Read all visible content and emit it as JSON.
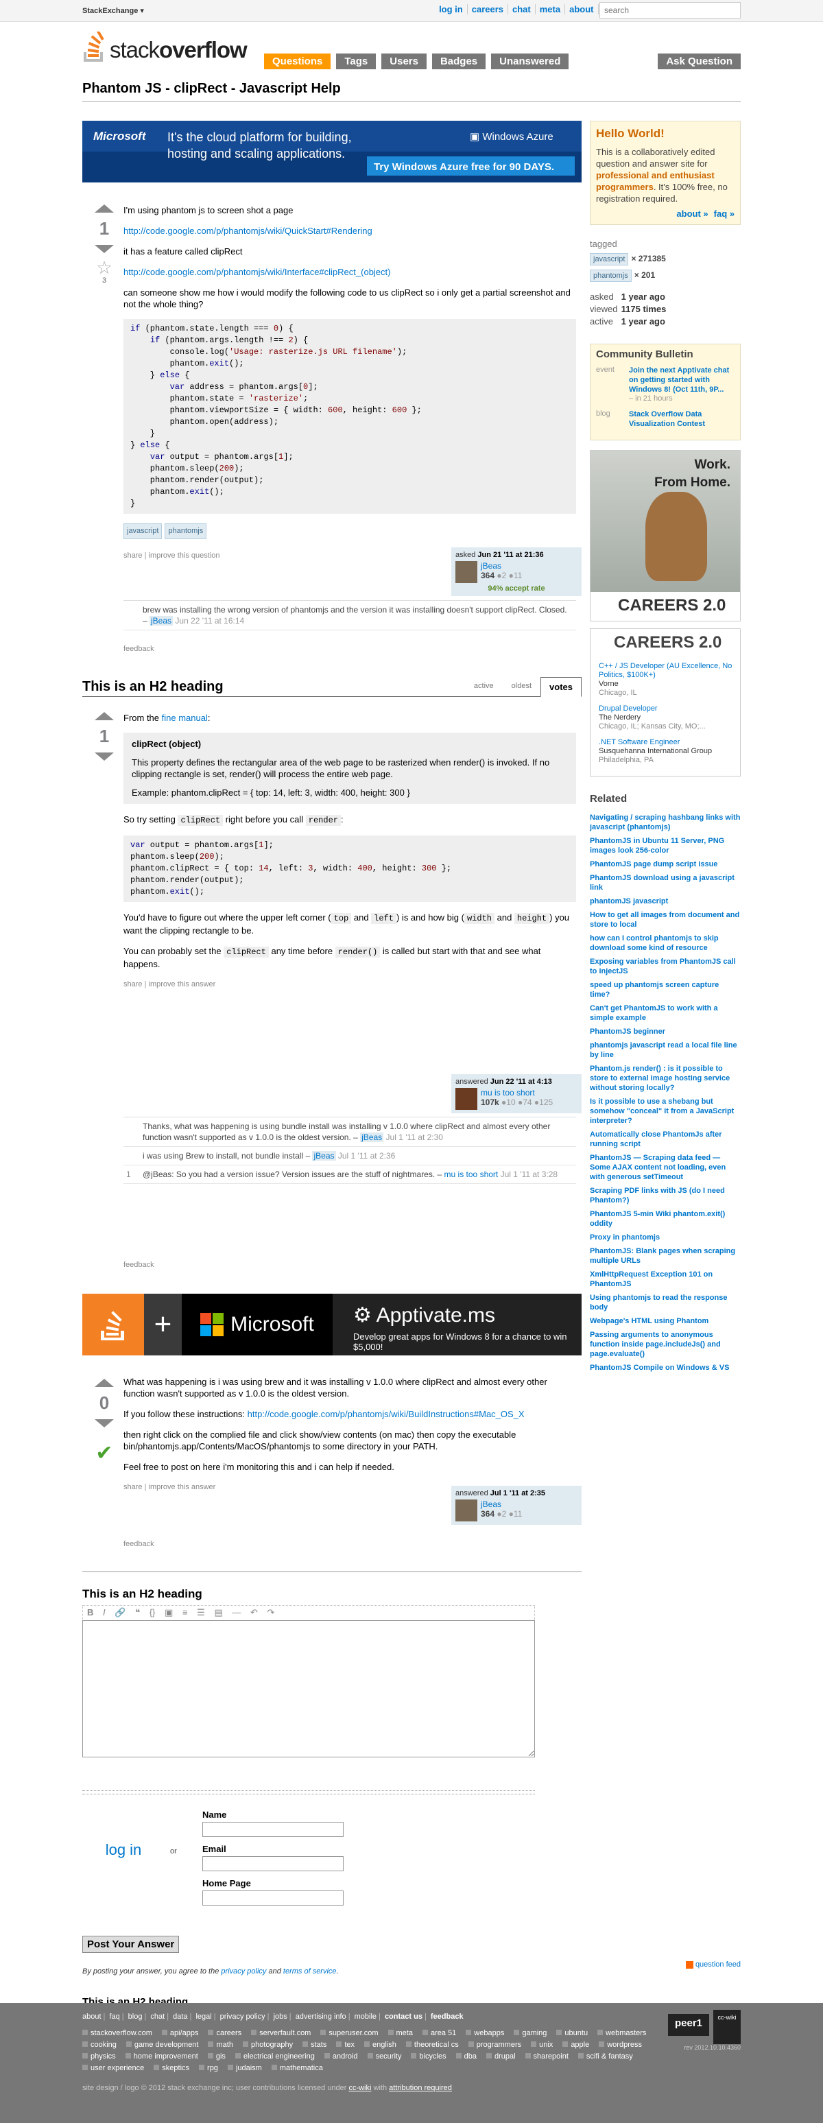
{
  "topbar": {
    "stackexchange_label": "StackExchange ▾",
    "links": [
      "log in",
      "careers",
      "chat",
      "meta",
      "about",
      "faq"
    ],
    "search_placeholder": "search"
  },
  "header": {
    "logo_text_light": "stack",
    "logo_text_bold": "overflow",
    "nav": [
      "Questions",
      "Tags",
      "Users",
      "Badges",
      "Unanswered"
    ],
    "ask_button": "Ask Question"
  },
  "question": {
    "title": "Phantom JS - clipRect - Javascript Help",
    "votes": "1",
    "favorites": "3",
    "p1": "I'm using phantom js to screen shot a page",
    "link1": "http://code.google.com/p/phantomjs/wiki/QuickStart#Rendering",
    "p2": "it has a feature called clipRect",
    "link2": "http://code.google.com/p/phantomjs/wiki/Interface#clipRect_(object)",
    "p3": "can someone show me how i would modify the following code to us clipRect so i only get a partial screenshot and not the whole thing?",
    "tags": [
      "javascript",
      "phantomjs"
    ],
    "menu": [
      "share",
      "improve this question"
    ],
    "sig_action": "asked ",
    "sig_date": "Jun 21 '11 at 21:36",
    "user": "jBeas",
    "rep": "364",
    "badges": "●2 ●11",
    "accept_rate": "94% accept rate",
    "comment_text": "brew was installing the wrong version of phantomjs and the version it was installing doesn't support clipRect. Closed. – ",
    "comment_user": "jBeas",
    "comment_date": "Jun 22 '11 at 16:14",
    "feedback": "feedback"
  },
  "answers_header": {
    "title": "This is an H2 heading",
    "tabs": [
      "active",
      "oldest",
      "votes"
    ]
  },
  "answer1": {
    "votes": "1",
    "p_intro": "From the ",
    "p_intro_link": "fine manual",
    "p_intro_end": ":",
    "bq_title": "clipRect (object)",
    "bq_text": "This property defines the rectangular area of the web page to be rasterized when render() is invoked. If no clipping rectangle is set, render() will process the entire web page.",
    "bq_example": "Example:   phantom.clipRect = { top: 14, left: 3, width: 400, height: 300 }",
    "p2a": "So try setting ",
    "p2_code": "clipRect",
    "p2b": " right before you call ",
    "p2_code2": "render",
    "p2c": ":",
    "p3a": "You'd have to figure out where the upper left corner (",
    "p3_top": "top",
    "p3b": " and ",
    "p3_left": "left",
    "p3c": ") is and how big (",
    "p3_width": "width",
    "p3d": " and ",
    "p3_height": "height",
    "p3e": ") you want the clipping rectangle to be.",
    "p4a": "You can probably set the ",
    "p4_code": "clipRect",
    "p4b": " any time before ",
    "p4_code2": "render()",
    "p4c": " is called but start with that and see what happens.",
    "menu": [
      "share",
      "improve this answer"
    ],
    "sig_action": "answered ",
    "sig_date": "Jun 22 '11 at 4:13",
    "user": "mu is too short",
    "rep": "107k",
    "badges": "●10 ●74 ●125",
    "comments": [
      {
        "score": "",
        "text": "Thanks, what was happening is using bundle install was installing v 1.0.0 where clipRect and almost every other function wasn't supported as v 1.0.0 is the oldest version. – ",
        "user": "jBeas",
        "date": "Jul 1 '11 at 2:30"
      },
      {
        "score": "",
        "text": "i was using Brew to install, not bundle install – ",
        "user": "jBeas",
        "date": "Jul 1 '11 at 2:36"
      },
      {
        "score": "1",
        "text": "@jBeas: So you had a version issue? Version issues are the stuff of nightmares. – ",
        "user": "mu is too short",
        "date": "Jul 1 '11 at 3:28"
      }
    ],
    "feedback": "feedback"
  },
  "partner_banner": {
    "ms": "Microsoft",
    "app": "Apptivate.ms",
    "sub": "Develop great apps for Windows 8 for a chance to win $5,000!"
  },
  "answer2": {
    "votes": "0",
    "p1": "What was happening is i was using brew and it was installing v 1.0.0 where clipRect and almost every other function wasn't supported as v 1.0.0 is the oldest version.",
    "p2a": "If you follow these instructions: ",
    "p2_link": "http://code.google.com/p/phantomjs/wiki/BuildInstructions#Mac_OS_X",
    "p3": "then right click on the complied file and click show/view contents (on mac) then copy the executable bin/phantomjs.app/Contents/MacOS/phantomjs to some directory in your PATH.",
    "p4": "Feel free to post on here i'm monitoring this and i can help if needed.",
    "menu": [
      "share",
      "improve this answer"
    ],
    "sig_action": "answered ",
    "sig_date": "Jul 1 '11 at 2:35",
    "user": "jBeas",
    "rep": "364",
    "badges": "●2 ●11",
    "feedback": "feedback"
  },
  "your_answer": {
    "title": "This is an H2 heading",
    "name_label": "Name",
    "email_label": "Email",
    "homepage_label": "Home Page",
    "login_link": "log in",
    "or": "or",
    "post_button": "Post Your Answer",
    "legal_a": "By posting your answer, you agree to the ",
    "privacy": "privacy policy",
    "legal_and": " and ",
    "terms": "terms of service",
    "legal_end": ".",
    "bottom_heading": "This is an H2 heading"
  },
  "sidebar": {
    "hello_title": "Hello World!",
    "hello_a": "This is a collaboratively edited question and answer site for ",
    "hello_b": "professional and enthusiast programmers",
    "hello_c": ". It's 100% free, no registration required.",
    "about": "about »",
    "faq": "faq »",
    "tagged": "tagged",
    "tag1": "javascript",
    "tag1_count": "× 271385",
    "tag2": "phantomjs",
    "tag2_count": "× 201",
    "asked_k": "asked",
    "asked_v": "1 year ago",
    "viewed_k": "viewed",
    "viewed_v": "1175 times",
    "active_k": "active",
    "active_v": "1 year ago",
    "community_title": "Community Bulletin",
    "cb_event_type": "event",
    "cb_event": "Join the next Apptivate chat on getting started with Windows 8! (Oct 11th, 9P...",
    "cb_event_time": "– in 21 hours",
    "cb_blog_type": "blog",
    "cb_blog": "Stack Overflow Data Visualization Contest",
    "ad_text1": "Work.",
    "ad_text2": "From Home.",
    "ad_careers": "CAREERS 2.0",
    "careers_logo": "CAREERS 2.0",
    "jobs": [
      {
        "title": "C++ / JS Developer (AU Excellence, No Politics, $100K+)",
        "company": "Vorne",
        "location": "Chicago, IL"
      },
      {
        "title": "Drupal Developer",
        "company": "The Nerdery",
        "location": "Chicago, IL; Kansas City, MO;..."
      },
      {
        "title": ".NET Software Engineer",
        "company": "Susquehanna International Group",
        "location": "Philadelphia, PA"
      }
    ],
    "related_title": "Related",
    "related": [
      "Navigating / scraping hashbang links with javascript (phantomjs)",
      "PhantomJS in Ubuntu 11 Server, PNG images look 256-color",
      "PhantomJS page dump script issue",
      "PhantomJS download using a javascript link",
      "phantomJS javascript",
      "How to get all images from document and store to local",
      "how can I control phantomjs to skip download some kind of resource",
      "Exposing variables from PhantomJS call to injectJS",
      "speed up phantomjs screen capture time?",
      "Can't get PhantomJS to work with a simple example",
      "PhantomJS beginner",
      "phantomjs javascript read a local file line by line",
      "Phantom.js render() : is it possible to store to external image hosting service without storing locally?",
      "Is it possible to use a shebang but somehow \"conceal\" it from a JavaScript interpreter?",
      "Automatically close PhantomJs after running script",
      "PhantomJS — Scraping data feed — Some AJAX content not loading, even with generous setTimeout",
      "Scraping PDF links with JS (do I need Phantom?)",
      "PhantomJS 5-min Wiki phantom.exit() oddity",
      "Proxy in phantomjs",
      "PhantomJS: Blank pages when scraping multiple URLs",
      "XmlHttpRequest Exception 101 on PhantomJS",
      "Using phantomjs to read the response body",
      "Webpage's HTML using Phantom",
      "Passing arguments to anonymous function inside page.includeJs() and page.evaluate()",
      "PhantomJS Compile on Windows & VS"
    ]
  },
  "footer": {
    "rss": "question feed",
    "menu": [
      "about",
      "faq",
      "blog",
      "chat",
      "data",
      "legal",
      "privacy policy",
      "jobs",
      "advertising info",
      "mobile",
      "contact us",
      "feedback"
    ],
    "sites": [
      "stackoverflow.com",
      "api/apps",
      "careers",
      "serverfault.com",
      "superuser.com",
      "meta",
      "area 51",
      "webapps",
      "gaming",
      "ubuntu",
      "webmasters",
      "cooking",
      "game development",
      "math",
      "photography",
      "stats",
      "tex",
      "english",
      "theoretical cs",
      "programmers",
      "unix",
      "apple",
      "wordpress",
      "physics",
      "home improvement",
      "gis",
      "electrical engineering",
      "android",
      "security",
      "bicycles",
      "dba",
      "drupal",
      "sharepoint",
      "scifi & fantasy",
      "user experience",
      "skeptics",
      "rpg",
      "judaism",
      "mathematica"
    ],
    "copy_a": "site design / logo © 2012 stack exchange inc; user contributions licensed under ",
    "copy_ccwiki": "cc-wiki",
    "copy_b": " with ",
    "copy_attr": "attribution required",
    "peer1": "peer1",
    "ccwiki_badge": "cc-wiki",
    "rev": "rev 2012.10.10.4360"
  },
  "colors": {
    "accent": "#ff9900",
    "link": "#0077cc",
    "tag_bg": "#e0eaf1"
  }
}
